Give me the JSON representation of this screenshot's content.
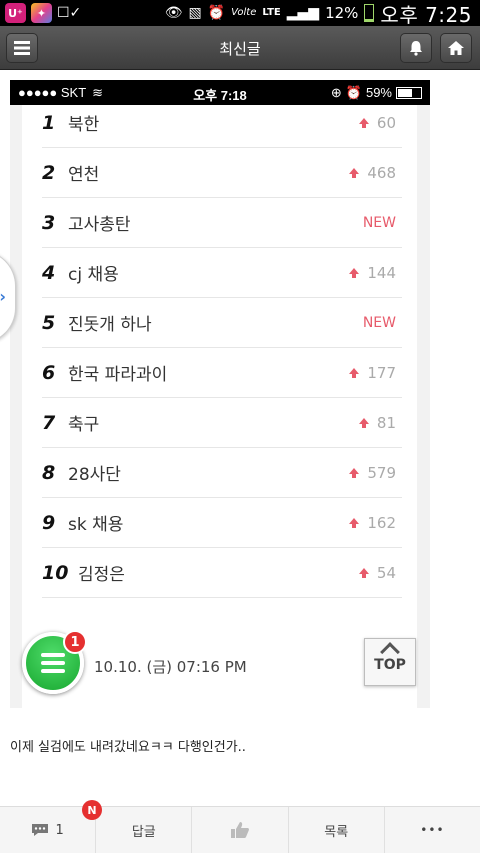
{
  "status_bar": {
    "network": "LTE",
    "battery": "12%",
    "time": "오후 7:25",
    "colors": {
      "background": "#000000",
      "battery": "#9fd66a"
    }
  },
  "app_bar": {
    "title": "최신글",
    "icons": {
      "menu": "menu-icon",
      "bell": "bell-icon",
      "home": "home-icon"
    }
  },
  "screenshot": {
    "ios_status": {
      "carrier": "●●●●● SKT",
      "time": "오후 7:18",
      "battery": "59%"
    },
    "rankings": [
      {
        "rank": "1",
        "term": "북한",
        "change": "60",
        "new": false
      },
      {
        "rank": "2",
        "term": "연천",
        "change": "468",
        "new": false
      },
      {
        "rank": "3",
        "term": "고사총탄",
        "change": "NEW",
        "new": true
      },
      {
        "rank": "4",
        "term": "cj 채용",
        "change": "144",
        "new": false
      },
      {
        "rank": "5",
        "term": "진돗개 하나",
        "change": "NEW",
        "new": true
      },
      {
        "rank": "6",
        "term": "한국 파라과이",
        "change": "177",
        "new": false
      },
      {
        "rank": "7",
        "term": "축구",
        "change": "81",
        "new": false
      },
      {
        "rank": "8",
        "term": "28사단",
        "change": "579",
        "new": false
      },
      {
        "rank": "9",
        "term": "sk 채용",
        "change": "162",
        "new": false
      },
      {
        "rank": "10",
        "term": "김정은",
        "change": "54",
        "new": false
      }
    ],
    "timestamp": "10.10. (금) 07:16 PM",
    "accent_color": "#e75b6b"
  },
  "floating": {
    "fab_badge": "1",
    "top_label": "TOP"
  },
  "post": {
    "text": "이제 실검에도 내려갔네요ㅋㅋ 다행인건가.."
  },
  "bottom_bar": {
    "comment_count": "1",
    "new_badge": "N",
    "reply_label": "답글",
    "list_label": "목록",
    "more_label": "•••"
  }
}
